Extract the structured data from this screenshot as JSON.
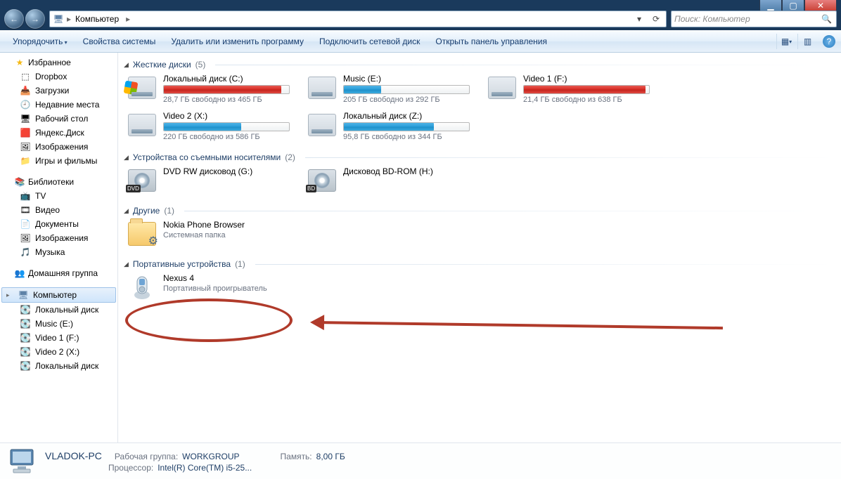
{
  "titlebar": {
    "min": "▁",
    "max": "▢",
    "close": "✕"
  },
  "nav": {
    "back": "←",
    "forward": "→",
    "crumb_root_icon": "🖥",
    "crumb_root": "Компьютер",
    "sep": "▸",
    "refresh": "⟳",
    "dropdown": "▾"
  },
  "search": {
    "placeholder": "Поиск: Компьютер",
    "icon": "🔍"
  },
  "cmdbar": {
    "organize": "Упорядочить",
    "props": "Свойства системы",
    "uninstall": "Удалить или изменить программу",
    "netdrive": "Подключить сетевой диск",
    "cpanel": "Открыть панель управления",
    "view_icon": "▦",
    "preview_icon": "▥",
    "help_icon": "?"
  },
  "sidebar": {
    "favorites": {
      "label": "Избранное",
      "items": [
        {
          "icon": "⬚",
          "label": "Dropbox"
        },
        {
          "icon": "📥",
          "label": "Загрузки"
        },
        {
          "icon": "🕘",
          "label": "Недавние места"
        },
        {
          "icon": "🖥",
          "label": "Рабочий стол"
        },
        {
          "icon": "🟥",
          "label": "Яндекс.Диск"
        },
        {
          "icon": "🖼",
          "label": "Изображения"
        },
        {
          "icon": "📁",
          "label": "Игры и фильмы"
        }
      ]
    },
    "libraries": {
      "label": "Библиотеки",
      "items": [
        {
          "icon": "📺",
          "label": "TV"
        },
        {
          "icon": "🎞",
          "label": "Видео"
        },
        {
          "icon": "📄",
          "label": "Документы"
        },
        {
          "icon": "🖼",
          "label": "Изображения"
        },
        {
          "icon": "🎵",
          "label": "Музыка"
        }
      ]
    },
    "homegroup": {
      "label": "Домашняя группа"
    },
    "computer": {
      "label": "Компьютер",
      "items": [
        {
          "icon": "💽",
          "label": "Локальный диск"
        },
        {
          "icon": "💽",
          "label": "Music (E:)"
        },
        {
          "icon": "💽",
          "label": "Video 1 (F:)"
        },
        {
          "icon": "💽",
          "label": "Video 2 (X:)"
        },
        {
          "icon": "💽",
          "label": "Локальный диск"
        }
      ]
    }
  },
  "content": {
    "cat_hdd": {
      "name": "Жесткие диски",
      "count": "(5)"
    },
    "hdd": [
      {
        "name": "Локальный диск (C:)",
        "sub": "28,7 ГБ свободно из 465 ГБ",
        "fill": 94,
        "color": "red",
        "win": true
      },
      {
        "name": "Music (E:)",
        "sub": "205 ГБ свободно из 292 ГБ",
        "fill": 30,
        "color": "blue"
      },
      {
        "name": "Video 1 (F:)",
        "sub": "21,4 ГБ свободно из 638 ГБ",
        "fill": 97,
        "color": "red"
      },
      {
        "name": "Video 2 (X:)",
        "sub": "220 ГБ свободно из 586 ГБ",
        "fill": 62,
        "color": "blue"
      },
      {
        "name": "Локальный диск (Z:)",
        "sub": "95,8 ГБ свободно из 344 ГБ",
        "fill": 72,
        "color": "blue"
      }
    ],
    "cat_removable": {
      "name": "Устройства со съемными носителями",
      "count": "(2)"
    },
    "removable": [
      {
        "name": "DVD RW дисковод (G:)",
        "badge": "DVD"
      },
      {
        "name": "Дисковод BD-ROM (H:)",
        "badge": "BD"
      }
    ],
    "cat_other": {
      "name": "Другие",
      "count": "(1)"
    },
    "other": [
      {
        "name": "Nokia Phone Browser",
        "sub": "Системная папка"
      }
    ],
    "cat_portable": {
      "name": "Портативные устройства",
      "count": "(1)"
    },
    "portable": [
      {
        "name": "Nexus 4",
        "sub": "Портативный проигрыватель"
      }
    ]
  },
  "details": {
    "pcname": "VLADOK-PC",
    "workgroup_k": "Рабочая группа:",
    "workgroup_v": "WORKGROUP",
    "cpu_k": "Процессор:",
    "cpu_v": "Intel(R) Core(TM) i5-25...",
    "mem_k": "Память:",
    "mem_v": "8,00 ГБ"
  }
}
